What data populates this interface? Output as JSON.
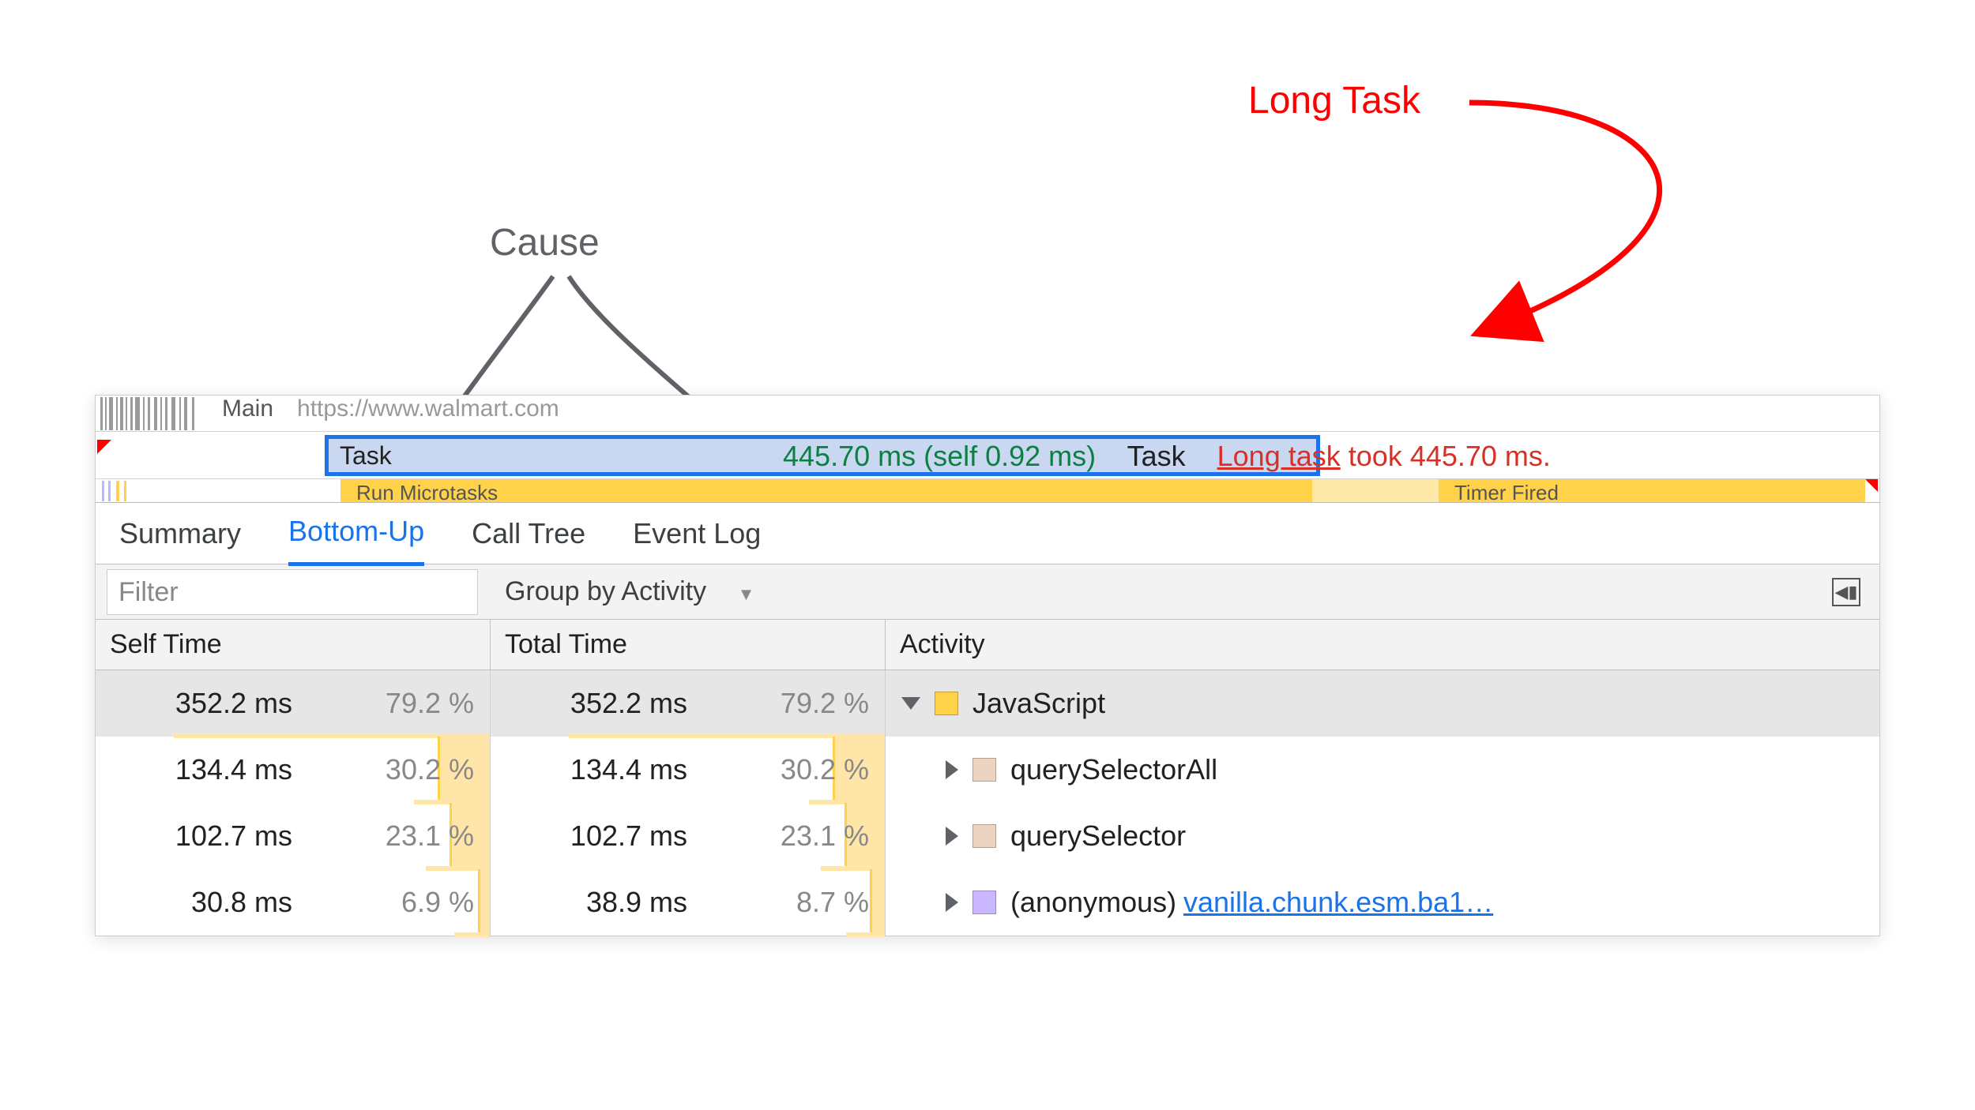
{
  "annotations": {
    "long_task": "Long Task",
    "cause": "Cause"
  },
  "track": {
    "main_label": "Main",
    "url_fragment": "https://www.walm",
    "url_fragment2": "art.com"
  },
  "task": {
    "bar_label": "Task",
    "time_self": "445.70 ms (self 0.92 ms)",
    "type": "Task",
    "warning_label": "Long task",
    "warning_rest": " took 445.70 ms."
  },
  "subtrack": {
    "microtasks": "Run Microtasks",
    "timer": "Timer Fired"
  },
  "tabs": [
    "Summary",
    "Bottom-Up",
    "Call Tree",
    "Event Log"
  ],
  "active_tab": 1,
  "filter": {
    "placeholder": "Filter",
    "group_label": "Group by Activity"
  },
  "headers": {
    "self": "Self Time",
    "total": "Total Time",
    "activity": "Activity"
  },
  "chart_data": {
    "type": "table",
    "columns": [
      "Self Time (ms)",
      "Self %",
      "Total Time (ms)",
      "Total %",
      "Activity",
      "Source"
    ],
    "rows": [
      [
        352.2,
        79.2,
        352.2,
        79.2,
        "JavaScript",
        null
      ],
      [
        134.4,
        30.2,
        134.4,
        30.2,
        "querySelectorAll",
        null
      ],
      [
        102.7,
        23.1,
        102.7,
        23.1,
        "querySelector",
        null
      ],
      [
        30.8,
        6.9,
        38.9,
        8.7,
        "(anonymous)",
        "vanilla.chunk.esm.ba1…"
      ]
    ]
  },
  "rows": [
    {
      "self_ms": "352.2 ms",
      "self_pct": "79.2 %",
      "total_ms": "352.2 ms",
      "total_pct": "79.2 %",
      "sq": "y",
      "name": "JavaScript",
      "open": true,
      "indent": 0,
      "link": ""
    },
    {
      "self_ms": "134.4 ms",
      "self_pct": "30.2 %",
      "total_ms": "134.4 ms",
      "total_pct": "30.2 %",
      "sq": "t",
      "name": "querySelectorAll",
      "open": false,
      "indent": 1,
      "link": ""
    },
    {
      "self_ms": "102.7 ms",
      "self_pct": "23.1 %",
      "total_ms": "102.7 ms",
      "total_pct": "23.1 %",
      "sq": "t",
      "name": "querySelector",
      "open": false,
      "indent": 1,
      "link": ""
    },
    {
      "self_ms": "30.8 ms",
      "self_pct": "6.9 %",
      "total_ms": "38.9 ms",
      "total_pct": "8.7 %",
      "sq": "p",
      "name": "(anonymous)",
      "open": false,
      "indent": 1,
      "link": "vanilla.chunk.esm.ba1…"
    }
  ]
}
